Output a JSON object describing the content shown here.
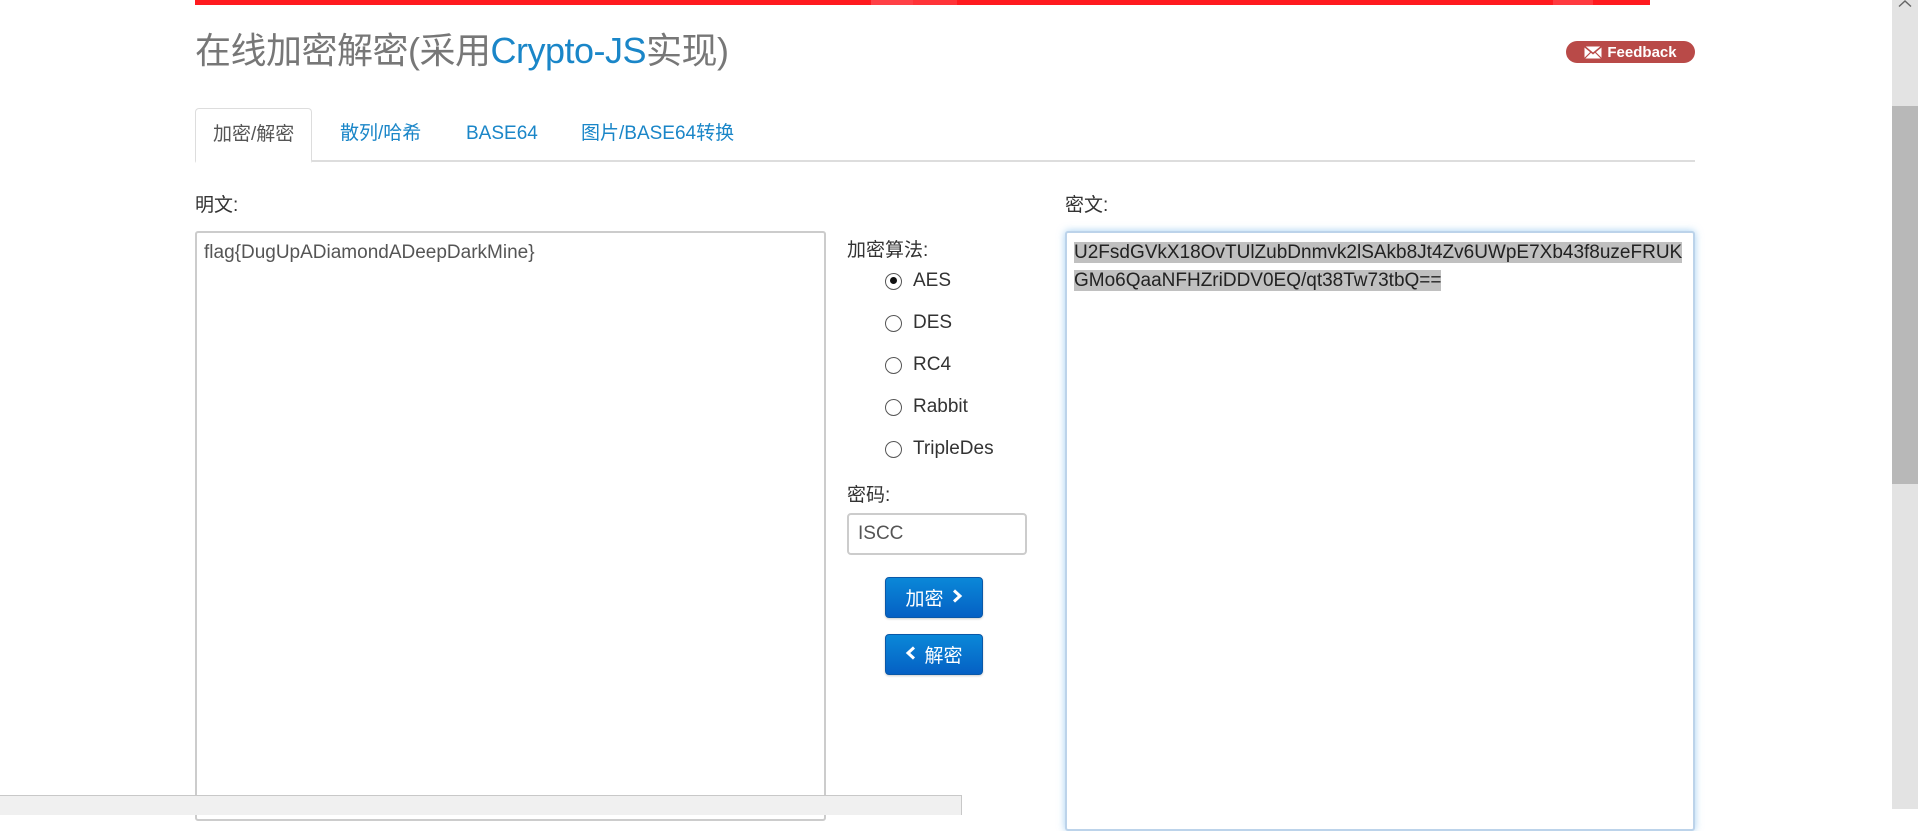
{
  "header": {
    "title_prefix": "在线加密解密(采用",
    "title_highlight": "Crypto-JS",
    "title_suffix": "实现)",
    "feedback_label": "Feedback",
    "accent_color": "#ff1a1f",
    "link_color": "#1a86c8"
  },
  "tabs": [
    {
      "label": "加密/解密",
      "active": true
    },
    {
      "label": "散列/哈希",
      "active": false
    },
    {
      "label": "BASE64",
      "active": false
    },
    {
      "label": "图片/BASE64转换",
      "active": false
    }
  ],
  "plaintext": {
    "label": "明文:",
    "value": "flag{DugUpADiamondADeepDarkMine}"
  },
  "algorithm": {
    "label": "加密算法:",
    "options": [
      {
        "label": "AES",
        "checked": true
      },
      {
        "label": "DES",
        "checked": false
      },
      {
        "label": "RC4",
        "checked": false
      },
      {
        "label": "Rabbit",
        "checked": false
      },
      {
        "label": "TripleDes",
        "checked": false
      }
    ]
  },
  "password": {
    "label": "密码:",
    "value": "ISCC"
  },
  "buttons": {
    "encrypt_label": "加密",
    "decrypt_label": "解密"
  },
  "ciphertext": {
    "label": "密文:",
    "value": "U2FsdGVkX18OvTUlZubDnmvk2lSAkb8Jt4Zv6UWpE7Xb43f8uzeFRUKGMo6QaaNFHZriDDV0EQ/qt38Tw73tbQ==",
    "selected": true
  }
}
